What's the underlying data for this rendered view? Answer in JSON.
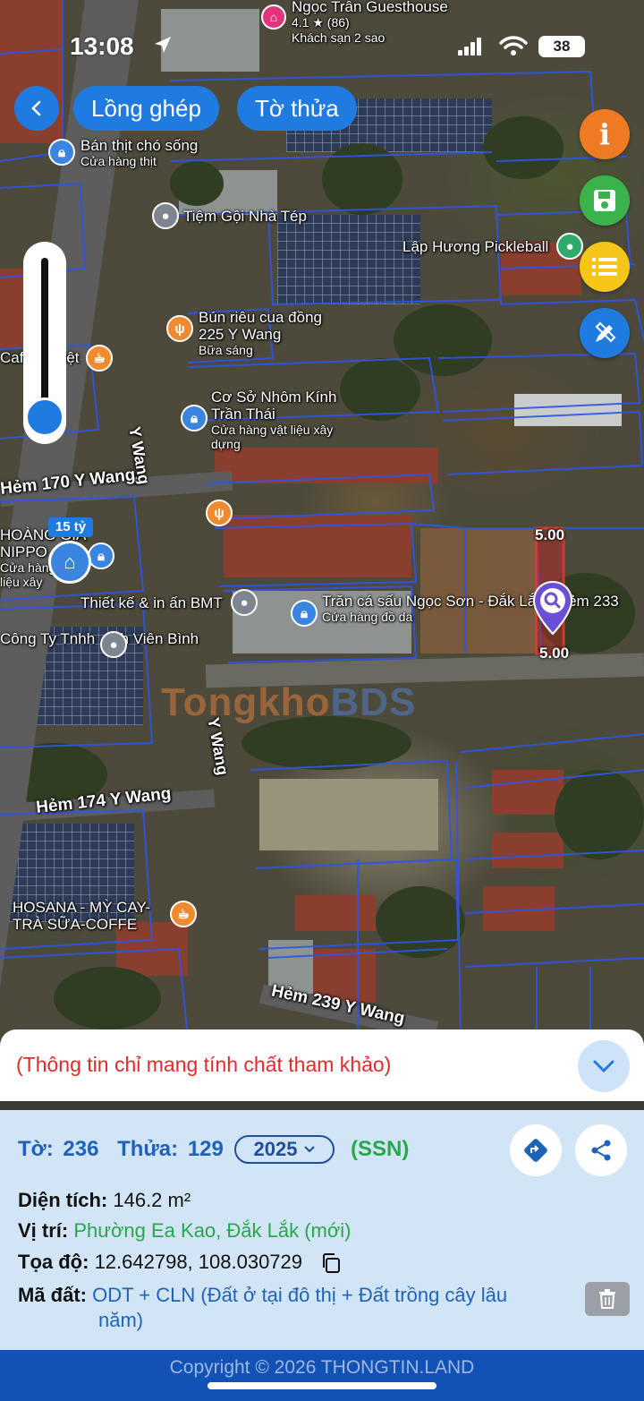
{
  "status_bar": {
    "time": "13:08",
    "battery": "38"
  },
  "toolbar": {
    "mode_label": "Lồng ghép",
    "sheet_label": "Tờ thửa"
  },
  "map": {
    "top_poi": {
      "name": "Ngọc Trân Guesthouse",
      "rating": "4.1 ★ (86)",
      "type": "Khách sạn 2 sao"
    },
    "roads": {
      "main": "Y Wang",
      "main2": "Y Wang",
      "alley1": "Hẻm 170 Y Wang",
      "alley2": "Hẻm 174 Y Wang",
      "alley3": "Hẻm 239 Y Wang"
    },
    "pois": [
      {
        "name": "Bán thịt chó sống",
        "sub": "Cửa hàng thịt"
      },
      {
        "name": "Tiệm Gội Nhà Tép",
        "sub": ""
      },
      {
        "name": "Lập Hương Pickleball",
        "sub": ""
      },
      {
        "name": "Bún riêu cua đồng 225 Y Wang",
        "sub": "Bữa sáng"
      },
      {
        "name": "Cafe ... Việt",
        "sub": ""
      },
      {
        "name": "Cơ Sở Nhôm Kính Trần Thái",
        "sub": "Cửa hàng vật liệu xây dựng"
      },
      {
        "name": "HOÀNG GIA NIPPO",
        "sub": "Cửa hàng vật liệu xây"
      },
      {
        "name": "Thiết kế & in ấn BMT",
        "sub": ""
      },
      {
        "name": "Trăn cá sấu Ngọc Sơn - Đắk Lắk ( Hẻm 233",
        "sub": "Cửa hàng đồ da"
      },
      {
        "name": "Công Ty Tnhh ...nh Viên Bình",
        "sub": ""
      },
      {
        "name": "HOSANA - MỲ CAY-TRÀ SỮA-COFFE",
        "sub": ""
      }
    ],
    "price_badge": "15 tỷ",
    "dimension_top": "5.00",
    "dimension_bottom": "5.00",
    "watermark": {
      "a": "Tongkho",
      "b": "BDS"
    }
  },
  "notice": {
    "text": "(Thông tin chỉ mang tính chất tham khảo)"
  },
  "parcel": {
    "sheet_label": "Tờ:",
    "sheet_value": "236",
    "lot_label": "Thửa:",
    "lot_value": "129",
    "year": "2025",
    "tag": "(SSN)",
    "area_label": "Diện tích:",
    "area_value": "146.2 m²",
    "location_label": "Vị trí:",
    "location_value": "Phường Ea Kao, Đắk Lắk (mới)",
    "coords_label": "Tọa độ:",
    "coords_value": "12.642798, 108.030729",
    "landcode_label": "Mã đất:",
    "landcode_value_line1": "ODT + CLN (Đất ở tại đô thị + Đất trồng cây lâu",
    "landcode_value_line2": "năm)"
  },
  "footer": {
    "copyright": "Copyright © 2026 THONGTIN.LAND"
  },
  "colors": {
    "accent": "#1f7be0",
    "warning": "#e12b2b",
    "success": "#27a84b",
    "footer": "#1252b5"
  }
}
